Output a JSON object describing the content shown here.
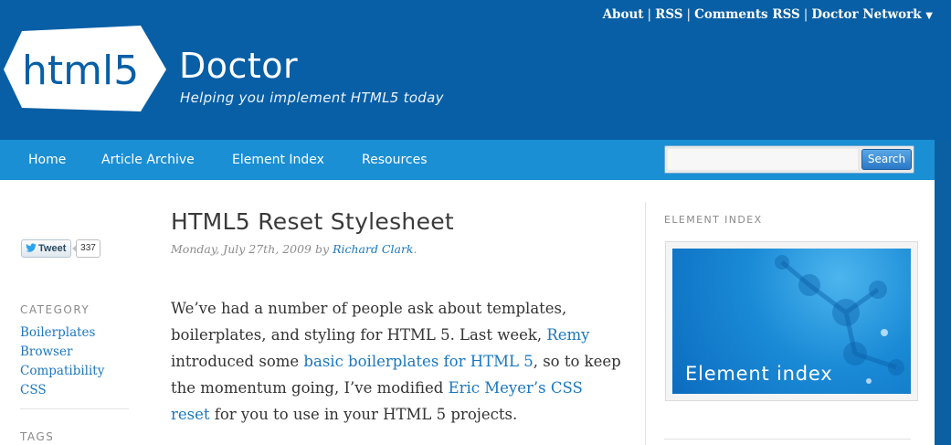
{
  "header": {
    "top_links": [
      "About",
      "RSS",
      "Comments RSS",
      "Doctor Network"
    ],
    "logo_badge_text": "html5",
    "site_name": "Doctor",
    "tagline": "Helping you implement HTML5 today"
  },
  "nav": {
    "items": [
      "Home",
      "Article Archive",
      "Element Index",
      "Resources"
    ],
    "search_placeholder": "",
    "search_button": "Search"
  },
  "social": {
    "tweet_label": "Tweet",
    "tweet_count": "337"
  },
  "sidebar_left": {
    "category_heading": "CATEGORY",
    "categories": [
      "Boilerplates",
      "Browser",
      "Compatibility",
      "CSS"
    ],
    "tags_heading": "TAGS"
  },
  "article": {
    "title": "HTML5 Reset Stylesheet",
    "date": "Monday, July 27th, 2009",
    "by": "by",
    "author": "Richard Clark",
    "author_suffix": ".",
    "body": {
      "p1": "We’ve had a number of people ask about templates, boilerplates, and styling for HTML 5. Last week, ",
      "link_remy": "Remy",
      "p2": " introduced some ",
      "link_boilerplates": "basic boilerplates for HTML 5",
      "p3": ", so to keep the momentum going, I’ve modified ",
      "link_reset": "Eric Meyer’s CSS reset",
      "p4": " for you to use in your HTML 5 projects."
    }
  },
  "sidebar_right": {
    "heading": "ELEMENT INDEX",
    "banner_label": "Element index"
  },
  "colors": {
    "header_bg": "#085fa6",
    "nav_bg": "#1a8fd4",
    "link": "#1a77c0"
  }
}
